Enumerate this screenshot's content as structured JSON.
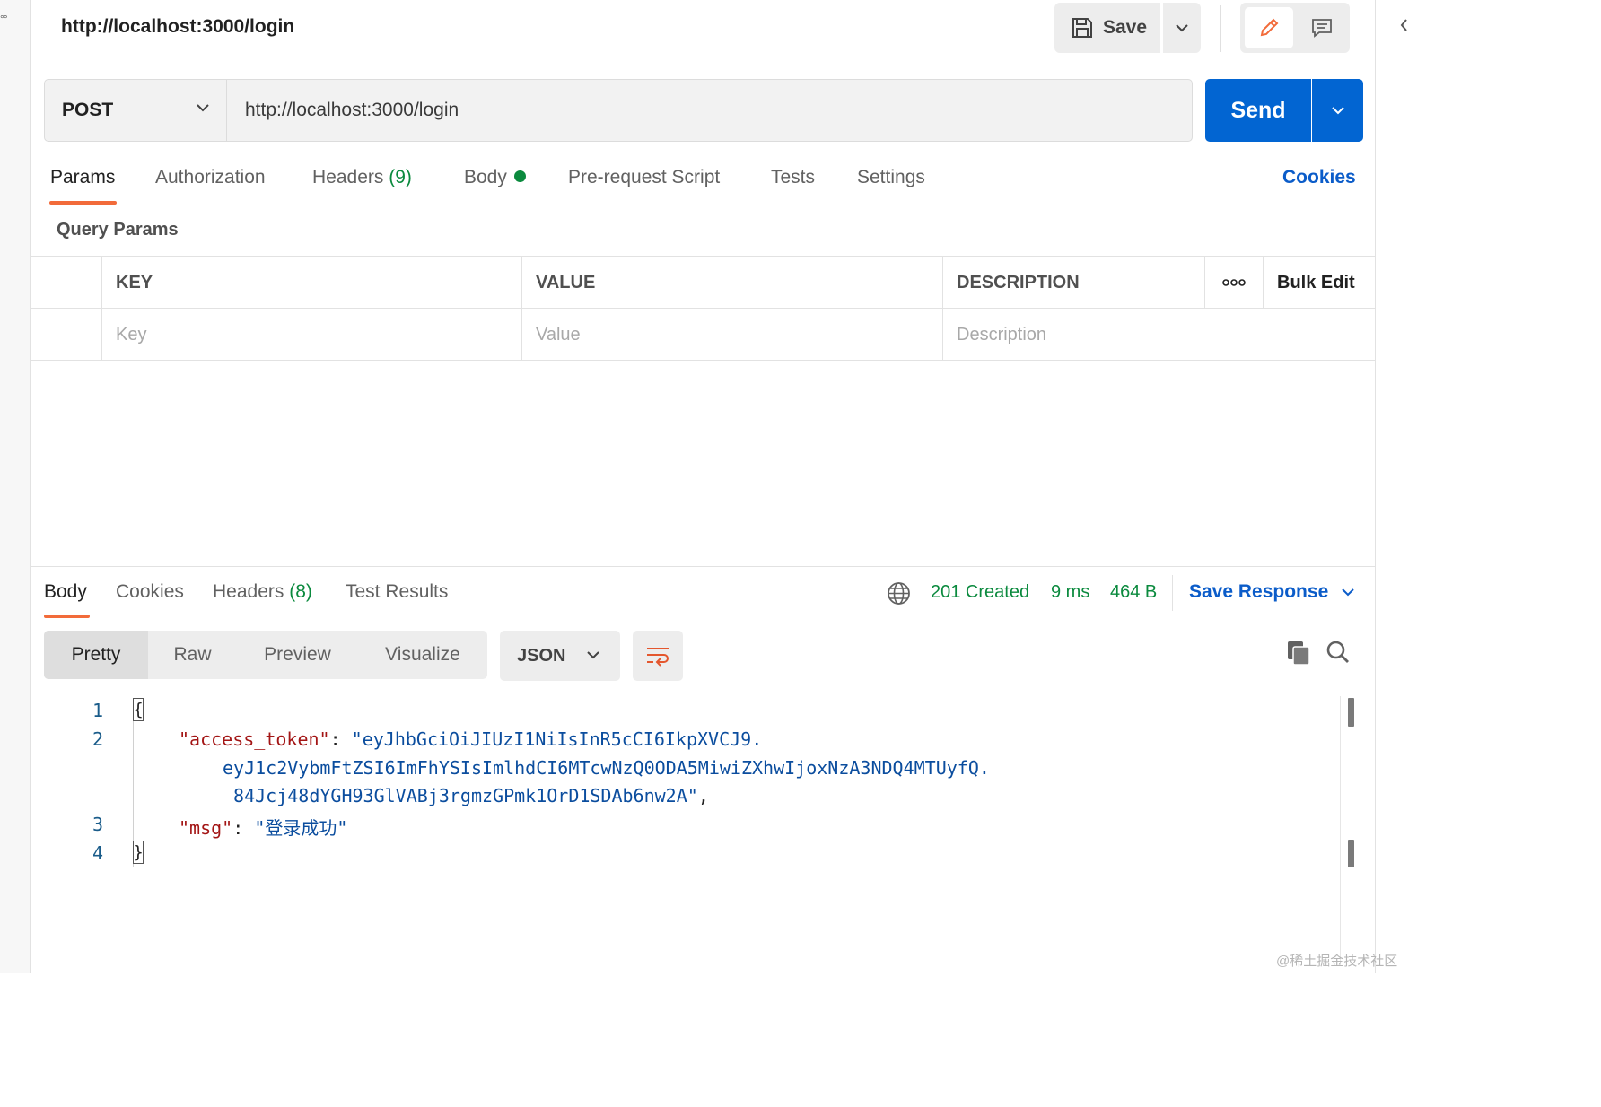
{
  "header": {
    "title": "http://localhost:3000/login",
    "save_label": "Save"
  },
  "request": {
    "method": "POST",
    "url": "http://localhost:3000/login",
    "send_label": "Send"
  },
  "request_tabs": {
    "params": "Params",
    "authorization": "Authorization",
    "headers": "Headers",
    "headers_count": "(9)",
    "body": "Body",
    "pre_request": "Pre-request Script",
    "tests": "Tests",
    "settings": "Settings",
    "cookies": "Cookies"
  },
  "params": {
    "section_title": "Query Params",
    "columns": {
      "key": "KEY",
      "value": "VALUE",
      "description": "DESCRIPTION",
      "more": "ooo",
      "bulk_edit": "Bulk Edit"
    },
    "placeholders": {
      "key": "Key",
      "value": "Value",
      "description": "Description"
    }
  },
  "response_tabs": {
    "body": "Body",
    "cookies": "Cookies",
    "headers": "Headers",
    "headers_count": "(8)",
    "test_results": "Test Results"
  },
  "response_meta": {
    "status": "201 Created",
    "time": "9 ms",
    "size": "464 B",
    "save_response": "Save Response"
  },
  "view_modes": {
    "pretty": "Pretty",
    "raw": "Raw",
    "preview": "Preview",
    "visualize": "Visualize"
  },
  "format": "JSON",
  "code": {
    "line_numbers": [
      "1",
      "2",
      "3",
      "4"
    ],
    "open_brace": "{",
    "close_brace": "}",
    "token_key": "\"access_token\"",
    "colon": ": ",
    "token_part1": "\"eyJhbGciOiJIUzI1NiIsInR5cCI6IkpXVCJ9.",
    "token_part2": "eyJ1c2VybmFtZSI6ImFhYSIsImlhdCI6MTcwNzQ0ODA5MiwiZXhwIjoxNzA3NDQ4MTUyfQ.",
    "token_part3": "_84Jcj48dYGH93GlVABj3rgmzGPmk1OrD1SDAb6nw2A\"",
    "comma": ",",
    "msg_key": "\"msg\"",
    "msg_value": "\"登录成功\""
  },
  "watermark": "@稀土掘金技术社区",
  "icons": {
    "save": "floppy-disk-icon",
    "edit": "pencil-icon",
    "comment": "comment-icon",
    "globe": "globe-icon",
    "copy": "copy-icon",
    "search": "search-icon",
    "wrap": "wrap-lines-icon"
  },
  "colors": {
    "accent_orange": "#f26b3a",
    "send_blue": "#0265d2",
    "link_blue": "#0b5cc9",
    "status_green": "#0b8a3e"
  }
}
